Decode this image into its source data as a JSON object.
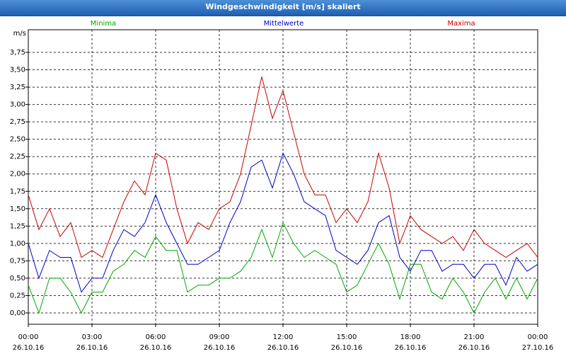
{
  "window": {
    "title": "Windgeschwindigkeit [m/s] skaliert"
  },
  "chart_data": {
    "type": "line",
    "unit": "m/s",
    "ylim": [
      0,
      3.75
    ],
    "yticks": [
      "0,00",
      "0,25",
      "0,50",
      "0,75",
      "1,00",
      "1,25",
      "1,50",
      "1,75",
      "2,00",
      "2,25",
      "2,50",
      "2,75",
      "3,00",
      "3,25",
      "3,50",
      "3,75"
    ],
    "xlim": [
      0,
      24
    ],
    "xticks": [
      {
        "time": "00:00",
        "date": "26.10.16"
      },
      {
        "time": "03:00",
        "date": "26.10.16"
      },
      {
        "time": "06:00",
        "date": "26.10.16"
      },
      {
        "time": "09:00",
        "date": "26.10.16"
      },
      {
        "time": "12:00",
        "date": "26.10.16"
      },
      {
        "time": "15:00",
        "date": "26.10.16"
      },
      {
        "time": "18:00",
        "date": "26.10.16"
      },
      {
        "time": "21:00",
        "date": "26.10.16"
      },
      {
        "time": "00:00",
        "date": "27.10.16"
      }
    ],
    "grid": true,
    "legend_placement": "top",
    "series": [
      {
        "name": "Minima",
        "color": "#00aa00",
        "x": [
          0,
          0.5,
          1,
          1.5,
          2,
          2.5,
          3,
          3.5,
          4,
          4.5,
          5,
          5.5,
          6,
          6.5,
          7,
          7.5,
          8,
          8.5,
          9,
          9.5,
          10,
          10.5,
          11,
          11.5,
          12,
          12.5,
          13,
          13.5,
          14,
          14.5,
          15,
          15.5,
          16,
          16.5,
          17,
          17.5,
          18,
          18.5,
          19,
          19.5,
          20,
          20.5,
          21,
          21.5,
          22,
          22.5,
          23,
          23.5,
          24
        ],
        "values": [
          0.4,
          0.0,
          0.5,
          0.5,
          0.3,
          0.0,
          0.3,
          0.3,
          0.6,
          0.7,
          0.9,
          0.8,
          1.1,
          0.9,
          0.9,
          0.3,
          0.4,
          0.4,
          0.5,
          0.5,
          0.6,
          0.8,
          1.2,
          0.8,
          1.3,
          1.0,
          0.8,
          0.9,
          0.8,
          0.7,
          0.3,
          0.4,
          0.7,
          1.0,
          0.7,
          0.2,
          0.7,
          0.7,
          0.3,
          0.2,
          0.5,
          0.3,
          0.0,
          0.3,
          0.5,
          0.2,
          0.5,
          0.2,
          0.5
        ]
      },
      {
        "name": "Mittelwerte",
        "color": "#0000cc",
        "x": [
          0,
          0.5,
          1,
          1.5,
          2,
          2.5,
          3,
          3.5,
          4,
          4.5,
          5,
          5.5,
          6,
          6.5,
          7,
          7.5,
          8,
          8.5,
          9,
          9.5,
          10,
          10.5,
          11,
          11.5,
          12,
          12.5,
          13,
          13.5,
          14,
          14.5,
          15,
          15.5,
          16,
          16.5,
          17,
          17.5,
          18,
          18.5,
          19,
          19.5,
          20,
          20.5,
          21,
          21.5,
          22,
          22.5,
          23,
          23.5,
          24
        ],
        "values": [
          1.0,
          0.5,
          0.9,
          0.8,
          0.8,
          0.3,
          0.5,
          0.5,
          0.9,
          1.2,
          1.1,
          1.3,
          1.7,
          1.3,
          1.0,
          0.7,
          0.7,
          0.8,
          0.9,
          1.3,
          1.6,
          2.1,
          2.2,
          1.8,
          2.3,
          2.0,
          1.6,
          1.5,
          1.4,
          0.9,
          0.8,
          0.7,
          0.9,
          1.3,
          1.4,
          0.8,
          0.6,
          0.9,
          0.9,
          0.6,
          0.7,
          0.7,
          0.5,
          0.7,
          0.7,
          0.4,
          0.8,
          0.6,
          0.7
        ]
      },
      {
        "name": "Maxima",
        "color": "#cc0000",
        "x": [
          0,
          0.5,
          1,
          1.5,
          2,
          2.5,
          3,
          3.5,
          4,
          4.5,
          5,
          5.5,
          6,
          6.5,
          7,
          7.5,
          8,
          8.5,
          9,
          9.5,
          10,
          10.5,
          11,
          11.5,
          12,
          12.5,
          13,
          13.5,
          14,
          14.5,
          15,
          15.5,
          16,
          16.5,
          17,
          17.5,
          18,
          18.5,
          19,
          19.5,
          20,
          20.5,
          21,
          21.5,
          22,
          22.5,
          23,
          23.5,
          24
        ],
        "values": [
          1.7,
          1.2,
          1.5,
          1.1,
          1.3,
          0.8,
          0.9,
          0.8,
          1.2,
          1.6,
          1.9,
          1.7,
          2.3,
          2.2,
          1.5,
          1.0,
          1.3,
          1.2,
          1.5,
          1.6,
          2.0,
          2.7,
          3.4,
          2.8,
          3.2,
          2.6,
          2.0,
          1.7,
          1.7,
          1.3,
          1.5,
          1.3,
          1.6,
          2.3,
          1.8,
          1.0,
          1.4,
          1.2,
          1.1,
          1.0,
          1.1,
          0.9,
          1.2,
          1.0,
          0.9,
          0.8,
          0.9,
          1.0,
          0.8
        ]
      }
    ]
  }
}
